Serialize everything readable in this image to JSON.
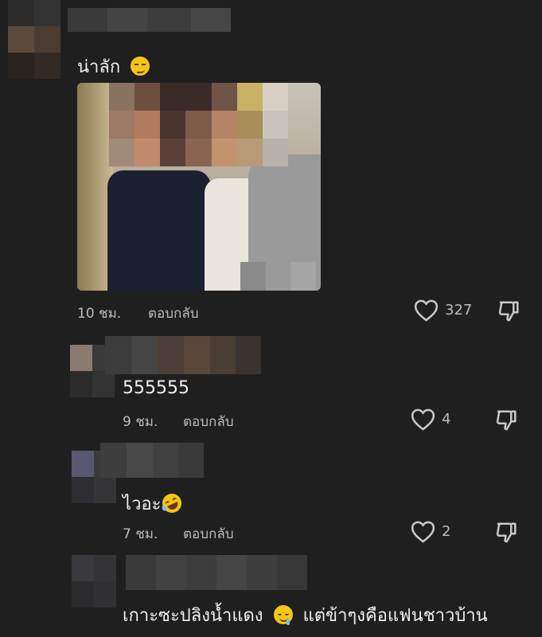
{
  "comments": [
    {
      "text": "น่าลัก",
      "emoji": "smirking-face",
      "time": "10 ชม.",
      "reply_label": "ตอบกลับ",
      "likes": "327",
      "has_image": true
    },
    {
      "text": "555555",
      "time": "9 ชม.",
      "reply_label": "ตอบกลับ",
      "likes": "4"
    },
    {
      "text": "ไวอะ",
      "emoji": "rolling-on-floor-laughing",
      "time": "7 ชม.",
      "reply_label": "ตอบกลับ",
      "likes": "2"
    },
    {
      "text_before": "เกาะซะปลิงน้ำแดง",
      "emoji": "drooling-face",
      "text_after": "แต่ข้าๆงคือแฟนชาวบ้าน"
    }
  ],
  "colors": {
    "background": "#1f1f1f",
    "text": "#f0f0f0",
    "secondary_text": "#bdbdbd",
    "emoji_yellow": "#f5c518"
  },
  "icons": [
    "heart-icon",
    "thumbs-down-icon"
  ]
}
